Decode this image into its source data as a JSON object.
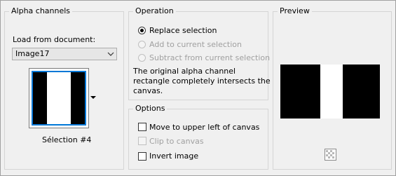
{
  "alpha_channels": {
    "title": "Alpha channels",
    "load_label": "Load from document:",
    "document_value": "Image17",
    "selection_caption": "Sélection #4"
  },
  "operation": {
    "title": "Operation",
    "options": [
      {
        "label": "Replace selection",
        "selected": true,
        "enabled": true
      },
      {
        "label": "Add to current selection",
        "selected": false,
        "enabled": false
      },
      {
        "label": "Subtract from current selection",
        "selected": false,
        "enabled": false
      }
    ],
    "description_lines": [
      "The original alpha channel",
      "rectangle completely intersects the",
      "canvas."
    ]
  },
  "options": {
    "title": "Options",
    "items": [
      {
        "label": "Move to upper left of canvas",
        "checked": false,
        "enabled": true
      },
      {
        "label": "Clip to canvas",
        "checked": false,
        "enabled": false
      },
      {
        "label": "Invert image",
        "checked": false,
        "enabled": true
      }
    ]
  },
  "preview": {
    "title": "Preview",
    "transparency_icon": "checkerboard-icon"
  },
  "colors": {
    "selection_border": "#0078d7",
    "disabled_text": "#a0a0a0"
  }
}
